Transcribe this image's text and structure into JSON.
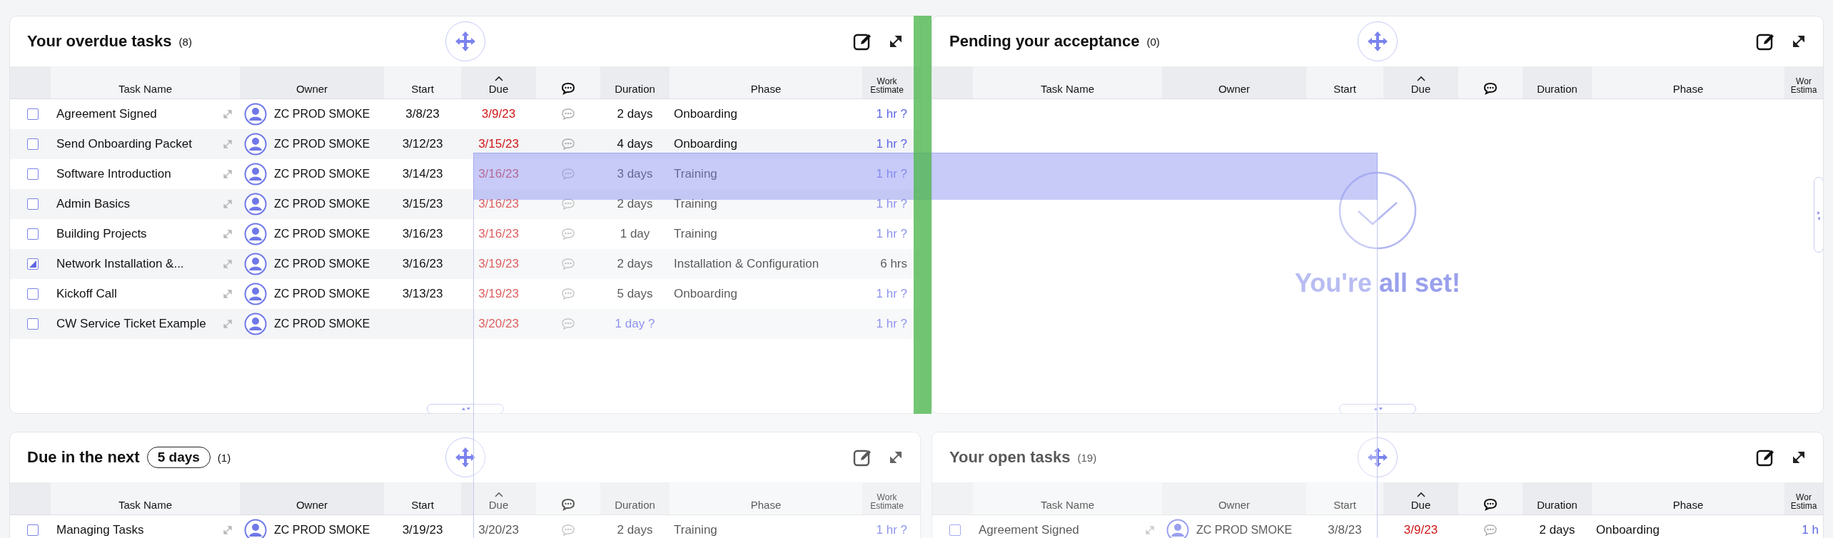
{
  "drag": {
    "active": true
  },
  "panels": [
    {
      "title": "Your overdue tasks",
      "count": "(8)",
      "columns": [
        {
          "kind": "text",
          "label": "Task Name",
          "sorted": false
        },
        {
          "kind": "text",
          "label": "Owner",
          "sorted": false
        },
        {
          "kind": "text",
          "label": "Start",
          "sorted": false
        },
        {
          "kind": "text",
          "label": "Due",
          "sorted": true
        },
        {
          "kind": "comments",
          "sorted": false
        },
        {
          "kind": "text",
          "label": "Duration",
          "sorted": false
        },
        {
          "kind": "text",
          "label": "Phase",
          "sorted": false
        },
        {
          "kind": "text",
          "label": "Work Estimate",
          "sorted": false
        }
      ],
      "rows": [
        {
          "checked": false,
          "task": "Agreement Signed",
          "owner": "ZC PROD SMOKE",
          "start": "3/8/23",
          "due": "3/9/23",
          "overdue": true,
          "duration": "2 days",
          "duration_tentative": false,
          "phase": "Onboarding",
          "estimate": "1 hr ?",
          "estimate_tentative": true
        },
        {
          "checked": false,
          "task": "Send Onboarding Packet",
          "owner": "ZC PROD SMOKE",
          "start": "3/12/23",
          "due": "3/15/23",
          "overdue": true,
          "duration": "4 days",
          "duration_tentative": false,
          "phase": "Onboarding",
          "estimate": "1 hr ?",
          "estimate_tentative": true
        },
        {
          "checked": false,
          "task": "Software Introduction",
          "owner": "ZC PROD SMOKE",
          "start": "3/14/23",
          "due": "3/16/23",
          "overdue": true,
          "duration": "3 days",
          "duration_tentative": false,
          "phase": "Training",
          "estimate": "1 hr ?",
          "estimate_tentative": true
        },
        {
          "checked": false,
          "task": "Admin Basics",
          "owner": "ZC PROD SMOKE",
          "start": "3/15/23",
          "due": "3/16/23",
          "overdue": true,
          "duration": "2 days",
          "duration_tentative": false,
          "phase": "Training",
          "estimate": "1 hr ?",
          "estimate_tentative": true
        },
        {
          "checked": false,
          "task": "Building Projects",
          "owner": "ZC PROD SMOKE",
          "start": "3/16/23",
          "due": "3/16/23",
          "overdue": true,
          "duration": "1 day",
          "duration_tentative": false,
          "phase": "Training",
          "estimate": "1 hr ?",
          "estimate_tentative": true
        },
        {
          "checked": true,
          "task": "Network Installation &...",
          "owner": "ZC PROD SMOKE",
          "start": "3/16/23",
          "due": "3/19/23",
          "overdue": true,
          "duration": "2 days",
          "duration_tentative": false,
          "phase": "Installation & Configuration",
          "estimate": "6 hrs",
          "estimate_tentative": false
        },
        {
          "checked": false,
          "task": "Kickoff Call",
          "owner": "ZC PROD SMOKE",
          "start": "3/13/23",
          "due": "3/19/23",
          "overdue": true,
          "duration": "5 days",
          "duration_tentative": false,
          "phase": "Onboarding",
          "estimate": "1 hr ?",
          "estimate_tentative": true
        },
        {
          "checked": false,
          "task": "CW Service Ticket Example",
          "owner": "ZC PROD SMOKE",
          "due": "3/20/23",
          "overdue": true,
          "duration": "1 day ?",
          "duration_tentative": true,
          "estimate": "1 hr ?",
          "estimate_tentative": true
        }
      ]
    },
    {
      "title": "Pending your acceptance",
      "count": "(0)",
      "empty_message": "You're all set!",
      "columns": [
        {
          "kind": "text",
          "label": "Task Name",
          "sorted": false
        },
        {
          "kind": "text",
          "label": "Owner",
          "sorted": false
        },
        {
          "kind": "text",
          "label": "Start",
          "sorted": false
        },
        {
          "kind": "text",
          "label": "Due",
          "sorted": true
        },
        {
          "kind": "comments",
          "sorted": false
        },
        {
          "kind": "text",
          "label": "Duration",
          "sorted": false
        },
        {
          "kind": "text",
          "label": "Phase",
          "sorted": false
        },
        {
          "kind": "text",
          "label": "Wor Estima",
          "sorted": false
        }
      ]
    },
    {
      "title": "Due in the next",
      "range": "5 days",
      "count": "(1)",
      "columns": [
        {
          "kind": "text",
          "label": "Task Name",
          "sorted": false
        },
        {
          "kind": "text",
          "label": "Owner",
          "sorted": false
        },
        {
          "kind": "text",
          "label": "Start",
          "sorted": false
        },
        {
          "kind": "text",
          "label": "Due",
          "sorted": true
        },
        {
          "kind": "comments",
          "sorted": false
        },
        {
          "kind": "text",
          "label": "Duration",
          "sorted": false
        },
        {
          "kind": "text",
          "label": "Phase",
          "sorted": false
        },
        {
          "kind": "text",
          "label": "Work Estimate",
          "sorted": false
        }
      ],
      "rows": [
        {
          "checked": false,
          "task": "Managing Tasks",
          "owner": "ZC PROD SMOKE",
          "start": "3/19/23",
          "due": "3/20/23",
          "overdue": false,
          "duration": "2 days",
          "duration_tentative": false,
          "phase": "Training",
          "estimate": "1 hr ?",
          "estimate_tentative": true
        }
      ]
    },
    {
      "title": "Your open tasks",
      "count": "(19)",
      "columns": [
        {
          "kind": "text",
          "label": "Task Name",
          "sorted": false
        },
        {
          "kind": "text",
          "label": "Owner",
          "sorted": false
        },
        {
          "kind": "text",
          "label": "Start",
          "sorted": false
        },
        {
          "kind": "text",
          "label": "Due",
          "sorted": true
        },
        {
          "kind": "comments",
          "sorted": false
        },
        {
          "kind": "text",
          "label": "Duration",
          "sorted": false
        },
        {
          "kind": "text",
          "label": "Phase",
          "sorted": false
        },
        {
          "kind": "text",
          "label": "Wor Estima",
          "sorted": false
        }
      ],
      "rows": [
        {
          "checked": false,
          "task": "Agreement Signed",
          "owner": "ZC PROD SMOKE",
          "start": "3/8/23",
          "due": "3/9/23",
          "overdue": true,
          "duration": "2 days",
          "duration_tentative": false,
          "phase": "Onboarding",
          "estimate": "1 h",
          "estimate_tentative": true
        }
      ]
    }
  ]
}
